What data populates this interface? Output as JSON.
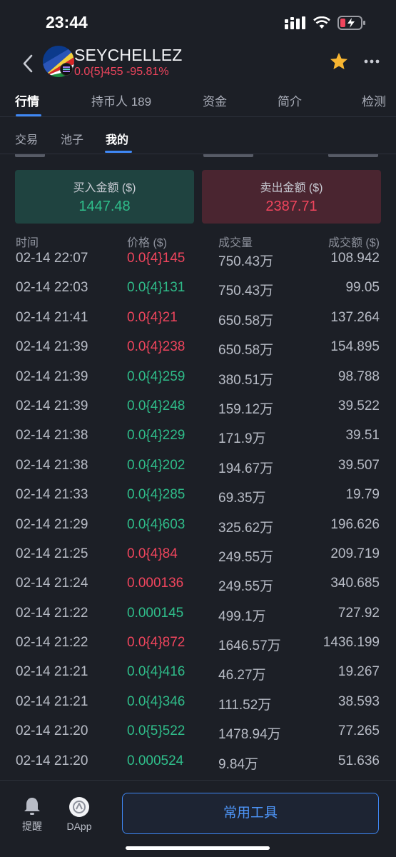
{
  "status_bar": {
    "time": "23:44"
  },
  "header": {
    "token_name": "SEYCHELLEZ",
    "token_price": "0.0{5}455 -95.81%"
  },
  "main_tabs": [
    {
      "label": "行情"
    },
    {
      "label": "持币人 189"
    },
    {
      "label": "资金"
    },
    {
      "label": "简介"
    },
    {
      "label": "检测"
    }
  ],
  "sub_tabs": [
    {
      "label": "交易"
    },
    {
      "label": "池子"
    },
    {
      "label": "我的"
    }
  ],
  "summary": {
    "buy_label": "买入金额 ($)",
    "buy_value": "1447.48",
    "sell_label": "卖出金额 ($)",
    "sell_value": "2387.71"
  },
  "table": {
    "headers": {
      "time": "时间",
      "price": "价格 ($)",
      "volume": "成交量",
      "amount": "成交额 ($)"
    },
    "rows": [
      {
        "time": "02-14 22:07",
        "price": "0.0{4}145",
        "dir": "down",
        "volume": "750.43万",
        "amount": "108.942"
      },
      {
        "time": "02-14 22:03",
        "price": "0.0{4}131",
        "dir": "up",
        "volume": "750.43万",
        "amount": "99.05"
      },
      {
        "time": "02-14 21:41",
        "price": "0.0{4}21",
        "dir": "down",
        "volume": "650.58万",
        "amount": "137.264"
      },
      {
        "time": "02-14 21:39",
        "price": "0.0{4}238",
        "dir": "down",
        "volume": "650.58万",
        "amount": "154.895"
      },
      {
        "time": "02-14 21:39",
        "price": "0.0{4}259",
        "dir": "up",
        "volume": "380.51万",
        "amount": "98.788"
      },
      {
        "time": "02-14 21:39",
        "price": "0.0{4}248",
        "dir": "up",
        "volume": "159.12万",
        "amount": "39.522"
      },
      {
        "time": "02-14 21:38",
        "price": "0.0{4}229",
        "dir": "up",
        "volume": "171.9万",
        "amount": "39.51"
      },
      {
        "time": "02-14 21:38",
        "price": "0.0{4}202",
        "dir": "up",
        "volume": "194.67万",
        "amount": "39.507"
      },
      {
        "time": "02-14 21:33",
        "price": "0.0{4}285",
        "dir": "up",
        "volume": "69.35万",
        "amount": "19.79"
      },
      {
        "time": "02-14 21:29",
        "price": "0.0{4}603",
        "dir": "up",
        "volume": "325.62万",
        "amount": "196.626"
      },
      {
        "time": "02-14 21:25",
        "price": "0.0{4}84",
        "dir": "down",
        "volume": "249.55万",
        "amount": "209.719"
      },
      {
        "time": "02-14 21:24",
        "price": "0.000136",
        "dir": "down",
        "volume": "249.55万",
        "amount": "340.685"
      },
      {
        "time": "02-14 21:22",
        "price": "0.000145",
        "dir": "up",
        "volume": "499.1万",
        "amount": "727.92"
      },
      {
        "time": "02-14 21:22",
        "price": "0.0{4}872",
        "dir": "down",
        "volume": "1646.57万",
        "amount": "1436.199"
      },
      {
        "time": "02-14 21:21",
        "price": "0.0{4}416",
        "dir": "up",
        "volume": "46.27万",
        "amount": "19.267"
      },
      {
        "time": "02-14 21:21",
        "price": "0.0{4}346",
        "dir": "up",
        "volume": "111.52万",
        "amount": "38.593"
      },
      {
        "time": "02-14 21:20",
        "price": "0.0{5}522",
        "dir": "up",
        "volume": "1478.94万",
        "amount": "77.265"
      },
      {
        "time": "02-14 21:20",
        "price": "0.000524",
        "dir": "up",
        "volume": "9.84万",
        "amount": "51.636"
      }
    ]
  },
  "bottom_bar": {
    "alert_label": "提醒",
    "dapp_label": "DApp",
    "tools_label": "常用工具"
  },
  "colors": {
    "up": "#2fbd8a",
    "down": "#f0455d",
    "accent": "#3f88f5",
    "background": "#1c1f26"
  },
  "icons": [
    "back-chevron-icon",
    "token-logo-icon",
    "chain-badge-icon",
    "star-icon",
    "more-icon",
    "signal-icon",
    "wifi-icon",
    "battery-icon",
    "bell-icon",
    "dapp-icon"
  ]
}
